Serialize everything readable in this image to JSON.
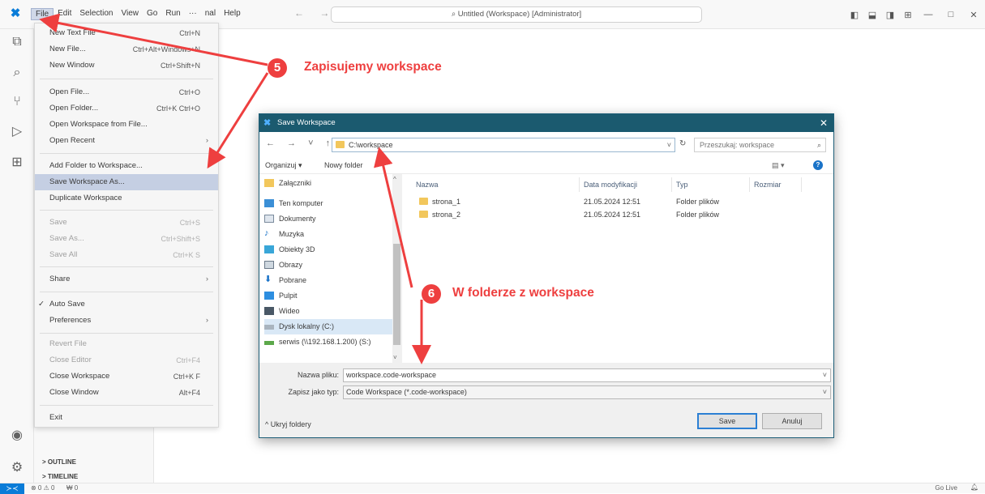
{
  "menubar": {
    "items": [
      "File",
      "Edit",
      "Selection",
      "View",
      "Go",
      "Run",
      "···",
      "nal",
      "Help"
    ],
    "nav_arrows": "← →",
    "command_center": "Untitled (Workspace) [Administrator]"
  },
  "window_controls": {
    "minimize": "—",
    "maximize": "□",
    "close": "✕"
  },
  "file_menu": {
    "new_text_file": {
      "label": "New Text File",
      "kb": "Ctrl+N"
    },
    "new_file": {
      "label": "New File...",
      "kb": "Ctrl+Alt+Windows+N"
    },
    "new_window": {
      "label": "New Window",
      "kb": "Ctrl+Shift+N"
    },
    "open_file": {
      "label": "Open File...",
      "kb": "Ctrl+O"
    },
    "open_folder": {
      "label": "Open Folder...",
      "kb": "Ctrl+K Ctrl+O"
    },
    "open_workspace": {
      "label": "Open Workspace from File..."
    },
    "open_recent": {
      "label": "Open Recent"
    },
    "add_folder": {
      "label": "Add Folder to Workspace..."
    },
    "save_workspace_as": {
      "label": "Save Workspace As..."
    },
    "duplicate_workspace": {
      "label": "Duplicate Workspace"
    },
    "save": {
      "label": "Save",
      "kb": "Ctrl+S"
    },
    "save_as": {
      "label": "Save As...",
      "kb": "Ctrl+Shift+S"
    },
    "save_all": {
      "label": "Save All",
      "kb": "Ctrl+K S"
    },
    "share": {
      "label": "Share"
    },
    "auto_save": {
      "label": "Auto Save",
      "check": "✓"
    },
    "preferences": {
      "label": "Preferences"
    },
    "revert_file": {
      "label": "Revert File"
    },
    "close_editor": {
      "label": "Close Editor",
      "kb": "Ctrl+F4"
    },
    "close_workspace": {
      "label": "Close Workspace",
      "kb": "Ctrl+K F"
    },
    "close_window": {
      "label": "Close Window",
      "kb": "Alt+F4"
    },
    "exit": {
      "label": "Exit"
    }
  },
  "sidebar": {
    "outline": "> OUTLINE",
    "timeline": "> TIMELINE"
  },
  "statusbar": {
    "problems": "⊗ 0 ⚠ 0",
    "ports": "₩ 0",
    "golive": "Go Live"
  },
  "dialog": {
    "title": "Save Workspace",
    "close": "✕",
    "nav": "← → ˅ ↑",
    "path": "C:\\workspace",
    "search_placeholder": "Przeszukaj: workspace",
    "organize": "Organizuj ▾",
    "new_folder": "Nowy folder",
    "view_toggle": "▤ ▾",
    "help": "?",
    "nav_pane": [
      {
        "label": "Załączniki",
        "icon": "folder-icon"
      },
      {
        "label": "Ten komputer",
        "icon": "computer-icon"
      },
      {
        "label": "Dokumenty",
        "icon": "documents-icon"
      },
      {
        "label": "Muzyka",
        "icon": "music-icon"
      },
      {
        "label": "Obiekty 3D",
        "icon": "objects-3d-icon"
      },
      {
        "label": "Obrazy",
        "icon": "pictures-icon"
      },
      {
        "label": "Pobrane",
        "icon": "downloads-icon"
      },
      {
        "label": "Pulpit",
        "icon": "desktop-icon"
      },
      {
        "label": "Wideo",
        "icon": "video-icon"
      },
      {
        "label": "Dysk lokalny (C:)",
        "icon": "drive-icon"
      },
      {
        "label": "serwis (\\\\192.168.1.200) (S:)",
        "icon": "network-drive-icon"
      }
    ],
    "columns": [
      "Nazwa",
      "Data modyfikacji",
      "Typ",
      "Rozmiar"
    ],
    "files": [
      {
        "name": "strona_1",
        "date": "21.05.2024 12:51",
        "type": "Folder plików"
      },
      {
        "name": "strona_2",
        "date": "21.05.2024 12:51",
        "type": "Folder plików"
      }
    ],
    "filename_label": "Nazwa pliku:",
    "filename": "workspace.code-workspace",
    "filetype_label": "Zapisz jako typ:",
    "filetype": "Code Workspace (*.code-workspace)",
    "hide_folders": "^ Ukryj foldery",
    "save_button": "Save",
    "cancel_button": "Anuluj"
  },
  "annotations": {
    "step5_num": "5",
    "step5_text": "Zapisujemy workspace",
    "step6_num": "6",
    "step6_text": "W folderze z workspace",
    "color": "#ee3f3f"
  }
}
